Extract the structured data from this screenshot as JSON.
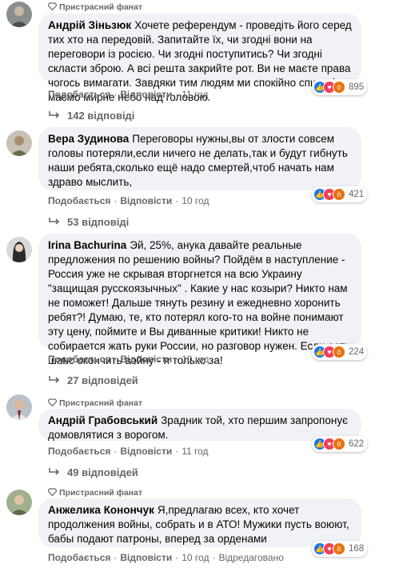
{
  "colors": {
    "bubble": "#f0f2f5",
    "like": "#1877f2",
    "love": "#f33e58",
    "angry": "#e9710f",
    "meta": "#65676b"
  },
  "comments": [
    {
      "badge": "Пристрасний фанат",
      "author": "Андрій Зіньзюк",
      "text": "Хочете референдум - проведіть його серед тих хто на передовій. Запитайте їх, чи згодні вони на переговори із росією. Чи згодні поступитись? Чи згодні скласти зброю. А всі решта закрийте рот. Ви не маєте права чогось вимагати. Завдяки тим людям ми спокійно спимо і маємо мирне небо над головою.",
      "like": "Подобається",
      "reply": "Відповісти",
      "time": "11 год",
      "reactions": [
        "like-icon",
        "love-icon",
        "angry-icon"
      ],
      "reaction_count": "895",
      "replies": "142 відповіді"
    },
    {
      "author": "Вера Зудинова",
      "text": "Переговоры нужны,вы от злости совсем головы потеряли,если ничего не делать,так и будут гибнуть наши ребята,сколько ещё надо смертей,чтоб начать нам здраво мыслить,",
      "like": "Подобається",
      "reply": "Відповісти",
      "time": "10 год",
      "reactions": [
        "like-icon",
        "love-icon",
        "angry-icon"
      ],
      "reaction_count": "421",
      "replies": "53 відповіді"
    },
    {
      "author": "Irina Bachurina",
      "text": "Эй, 25%, анука давайте реальные предложения по решению войны? Пойдём в наступление - Россия уже не скрывая вторгнется на всю Украину \"защищая русскоязычных\" . Какие у нас козыри? Никто нам не поможет! Дальше тянуть резину и ежедневно хоронить ребят?! Думаю, те, кто потерял кого-то на войне понимают эту цену, поймите и Вы диванные критики! Никто не собирается жать руки России, но разговор нужен. Если есть шанс окончить войну - я только за!",
      "like": "Подобається",
      "reply": "Відповісти",
      "time": "10 год",
      "reactions": [
        "like-icon",
        "love-icon",
        "angry-icon"
      ],
      "reaction_count": "224",
      "replies": "27 відповідей"
    },
    {
      "badge": "Пристрасний фанат",
      "author": "Андрій Грабовський",
      "text": "Зрадник той, хто першим запропонує домовлятися з ворогом.",
      "like": "Подобається",
      "reply": "Відповісти",
      "time": "11 год",
      "reactions": [
        "like-icon",
        "love-icon",
        "angry-icon"
      ],
      "reaction_count": "622",
      "replies": "49 відповідей"
    },
    {
      "badge": "Пристрасний фанат",
      "author": "Анжелика Конончук",
      "text": "Я,предлагаю всех, кто хочет продолжения войны, собрать и в АТО! Мужики пусть воюют, бабы подают патроны, вперед за орденами",
      "like": "Подобається",
      "reply": "Відповісти",
      "time": "10 год",
      "edited": "Відредаговано",
      "reactions": [
        "like-icon",
        "love-icon",
        "angry-icon"
      ],
      "reaction_count": "168"
    }
  ]
}
